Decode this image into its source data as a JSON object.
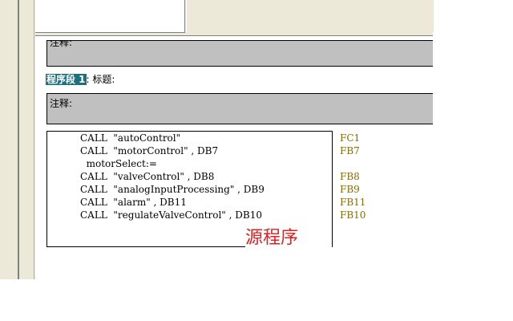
{
  "comment_label_1": "注释:",
  "network": {
    "label": "程序段 1",
    "suffix": ": 标题:"
  },
  "comment_label_2": "注释:",
  "code": [
    {
      "text": "CALL  \"autoControl\"",
      "ref": "FC1"
    },
    {
      "text": "CALL  \"motorControl\" , DB7",
      "ref": "FB7"
    },
    {
      "text": "  motorSelect:=",
      "ref": ""
    },
    {
      "text": "CALL  \"valveControl\" , DB8",
      "ref": "FB8"
    },
    {
      "text": "CALL  \"analogInputProcessing\" , DB9",
      "ref": "FB9"
    },
    {
      "text": "CALL  \"alarm\" , DB11",
      "ref": "FB11"
    },
    {
      "text": "CALL  \"regulateValveControl\" , DB10",
      "ref": "FB10"
    }
  ],
  "annotation": "源程序",
  "colors": {
    "network_label_bg": "#1f6f7a",
    "comment_bg": "#c0c0c0",
    "ref_color": "#8b6a00",
    "annotation_color": "#e02020"
  }
}
